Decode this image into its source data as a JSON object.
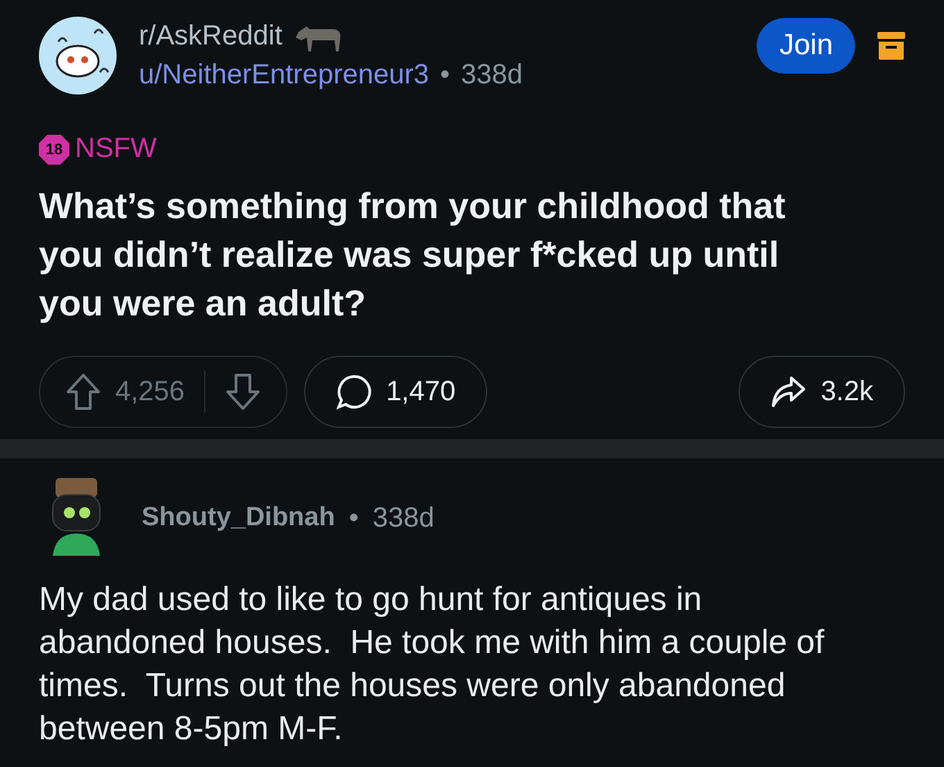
{
  "post": {
    "subreddit": "r/AskReddit",
    "author": "u/NeitherEntrepreneur3",
    "separator": "•",
    "age": "338d",
    "join_label": "Join",
    "nsfw": {
      "number": "18",
      "label": "NSFW"
    },
    "title": "What’s something from your childhood that you didn’t realize was super f*cked up until you were an adult?",
    "votes": "4,256",
    "comments": "1,470",
    "shares": "3.2k"
  },
  "comment": {
    "author": "Shouty_Dibnah",
    "separator": "•",
    "age": "338d",
    "body": "My dad used to like to go hunt for antiques in abandoned houses.  He took me with him a couple of times.  Turns out the houses were only abandoned between 8-5pm M-F."
  }
}
